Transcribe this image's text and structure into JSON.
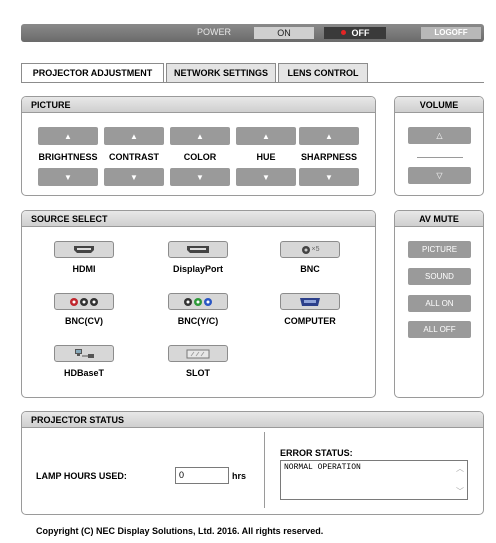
{
  "power": {
    "label": "POWER",
    "on": "ON",
    "off": "OFF",
    "logoff": "LOGOFF"
  },
  "tabs": [
    "PROJECTOR ADJUSTMENT",
    "NETWORK SETTINGS",
    "LENS CONTROL"
  ],
  "picture": {
    "title": "PICTURE",
    "controls": [
      "BRIGHTNESS",
      "CONTRAST",
      "COLOR",
      "HUE",
      "SHARPNESS"
    ],
    "up": "▲",
    "down": "▼"
  },
  "volume": {
    "title": "VOLUME",
    "up": "△",
    "down": "▽"
  },
  "source": {
    "title": "SOURCE SELECT",
    "items": [
      "HDMI",
      "DisplayPort",
      "BNC",
      "BNC(CV)",
      "BNC(Y/C)",
      "COMPUTER",
      "HDBaseT",
      "SLOT"
    ],
    "bnc_count": "×5"
  },
  "av_mute": {
    "title": "AV MUTE",
    "buttons": [
      "PICTURE",
      "SOUND",
      "ALL ON",
      "ALL OFF"
    ]
  },
  "status": {
    "title": "PROJECTOR STATUS",
    "lamp_label": "LAMP HOURS USED:",
    "lamp_value": "0",
    "lamp_unit": "hrs",
    "error_label": "ERROR STATUS:",
    "error_value": "NORMAL OPERATION"
  },
  "copyright": "Copyright (C) NEC Display Solutions, Ltd. 2016. All rights reserved.",
  "colors": {
    "active_off": "#3a3a3a",
    "indicator": "#e32525",
    "button_gray": "#9a9a9a"
  }
}
